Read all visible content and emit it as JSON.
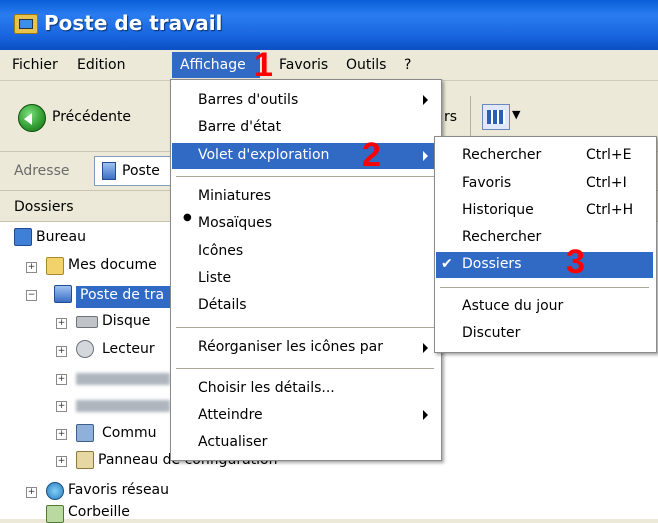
{
  "window": {
    "title": "Poste de travail"
  },
  "menubar": {
    "items": [
      "Fichier",
      "Edition",
      "Affichage",
      "Favoris",
      "Outils",
      "?"
    ]
  },
  "toolbar": {
    "back_label": "Précédente",
    "partial_label": "rs"
  },
  "address": {
    "label": "Adresse",
    "value": "Poste"
  },
  "folders_pane": {
    "header": "Dossiers"
  },
  "tree": {
    "bureau": "Bureau",
    "mes_documents": "Mes docume",
    "poste_de_travail": "Poste de tra",
    "disque": "Disque",
    "lecteur": "Lecteur",
    "commun": "Commu",
    "panneau": "Panneau de configuration",
    "favoris_reseau": "Favoris réseau",
    "corbeille": "Corbeille"
  },
  "affichage_menu": {
    "barres_outils": "Barres d'outils",
    "barre_etat": "Barre d'état",
    "volet_exploration": "Volet d'exploration",
    "miniatures": "Miniatures",
    "mosaiques": "Mosaïques",
    "icones": "Icônes",
    "liste": "Liste",
    "details": "Détails",
    "reorganiser": "Réorganiser les icônes par",
    "choisir_details": "Choisir les détails...",
    "atteindre": "Atteindre",
    "actualiser": "Actualiser"
  },
  "volet_submenu": {
    "rechercher1": "Rechercher",
    "rechercher1_shortcut": "Ctrl+E",
    "favoris": "Favoris",
    "favoris_shortcut": "Ctrl+I",
    "historique": "Historique",
    "historique_shortcut": "Ctrl+H",
    "rechercher2": "Rechercher",
    "dossiers": "Dossiers",
    "astuce": "Astuce du jour",
    "discuter": "Discuter"
  },
  "annotations": {
    "step1": "1",
    "step2": "2",
    "step3": "3"
  },
  "colors": {
    "highlight": "#316ac5",
    "titlebar": "#0a5fd8",
    "annotation": "#ff0000"
  }
}
